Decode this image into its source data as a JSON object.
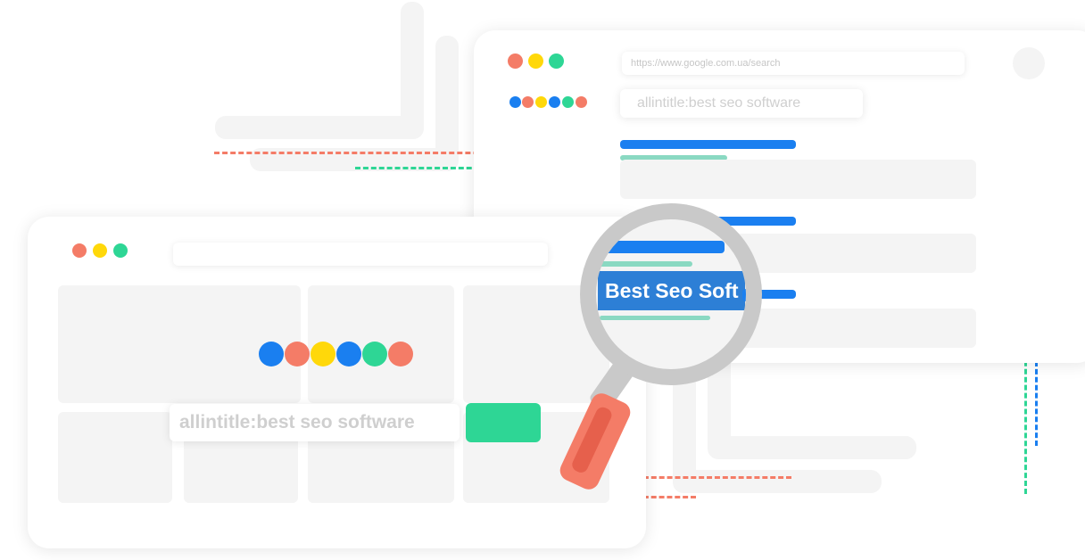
{
  "back_window": {
    "url": "https://www.google.com.ua/search",
    "query": "allintitle:best seo software",
    "result_count": 3
  },
  "front_window": {
    "query": "allintitle:best seo software"
  },
  "magnifier": {
    "highlight_text": "Best Seo Soft"
  },
  "colors": {
    "red": "#f47c67",
    "yellow": "#ffd80a",
    "green": "#2ed695",
    "blue": "#1a7ff0",
    "teal": "#8ad9c2",
    "handle": "#f47c67",
    "lens": "#c9c9c9"
  },
  "icons": {
    "window_controls": "traffic-light-dots",
    "logo": "google-colored-dots",
    "magnifier": "magnifying-glass-icon",
    "avatar": "avatar-circle"
  }
}
